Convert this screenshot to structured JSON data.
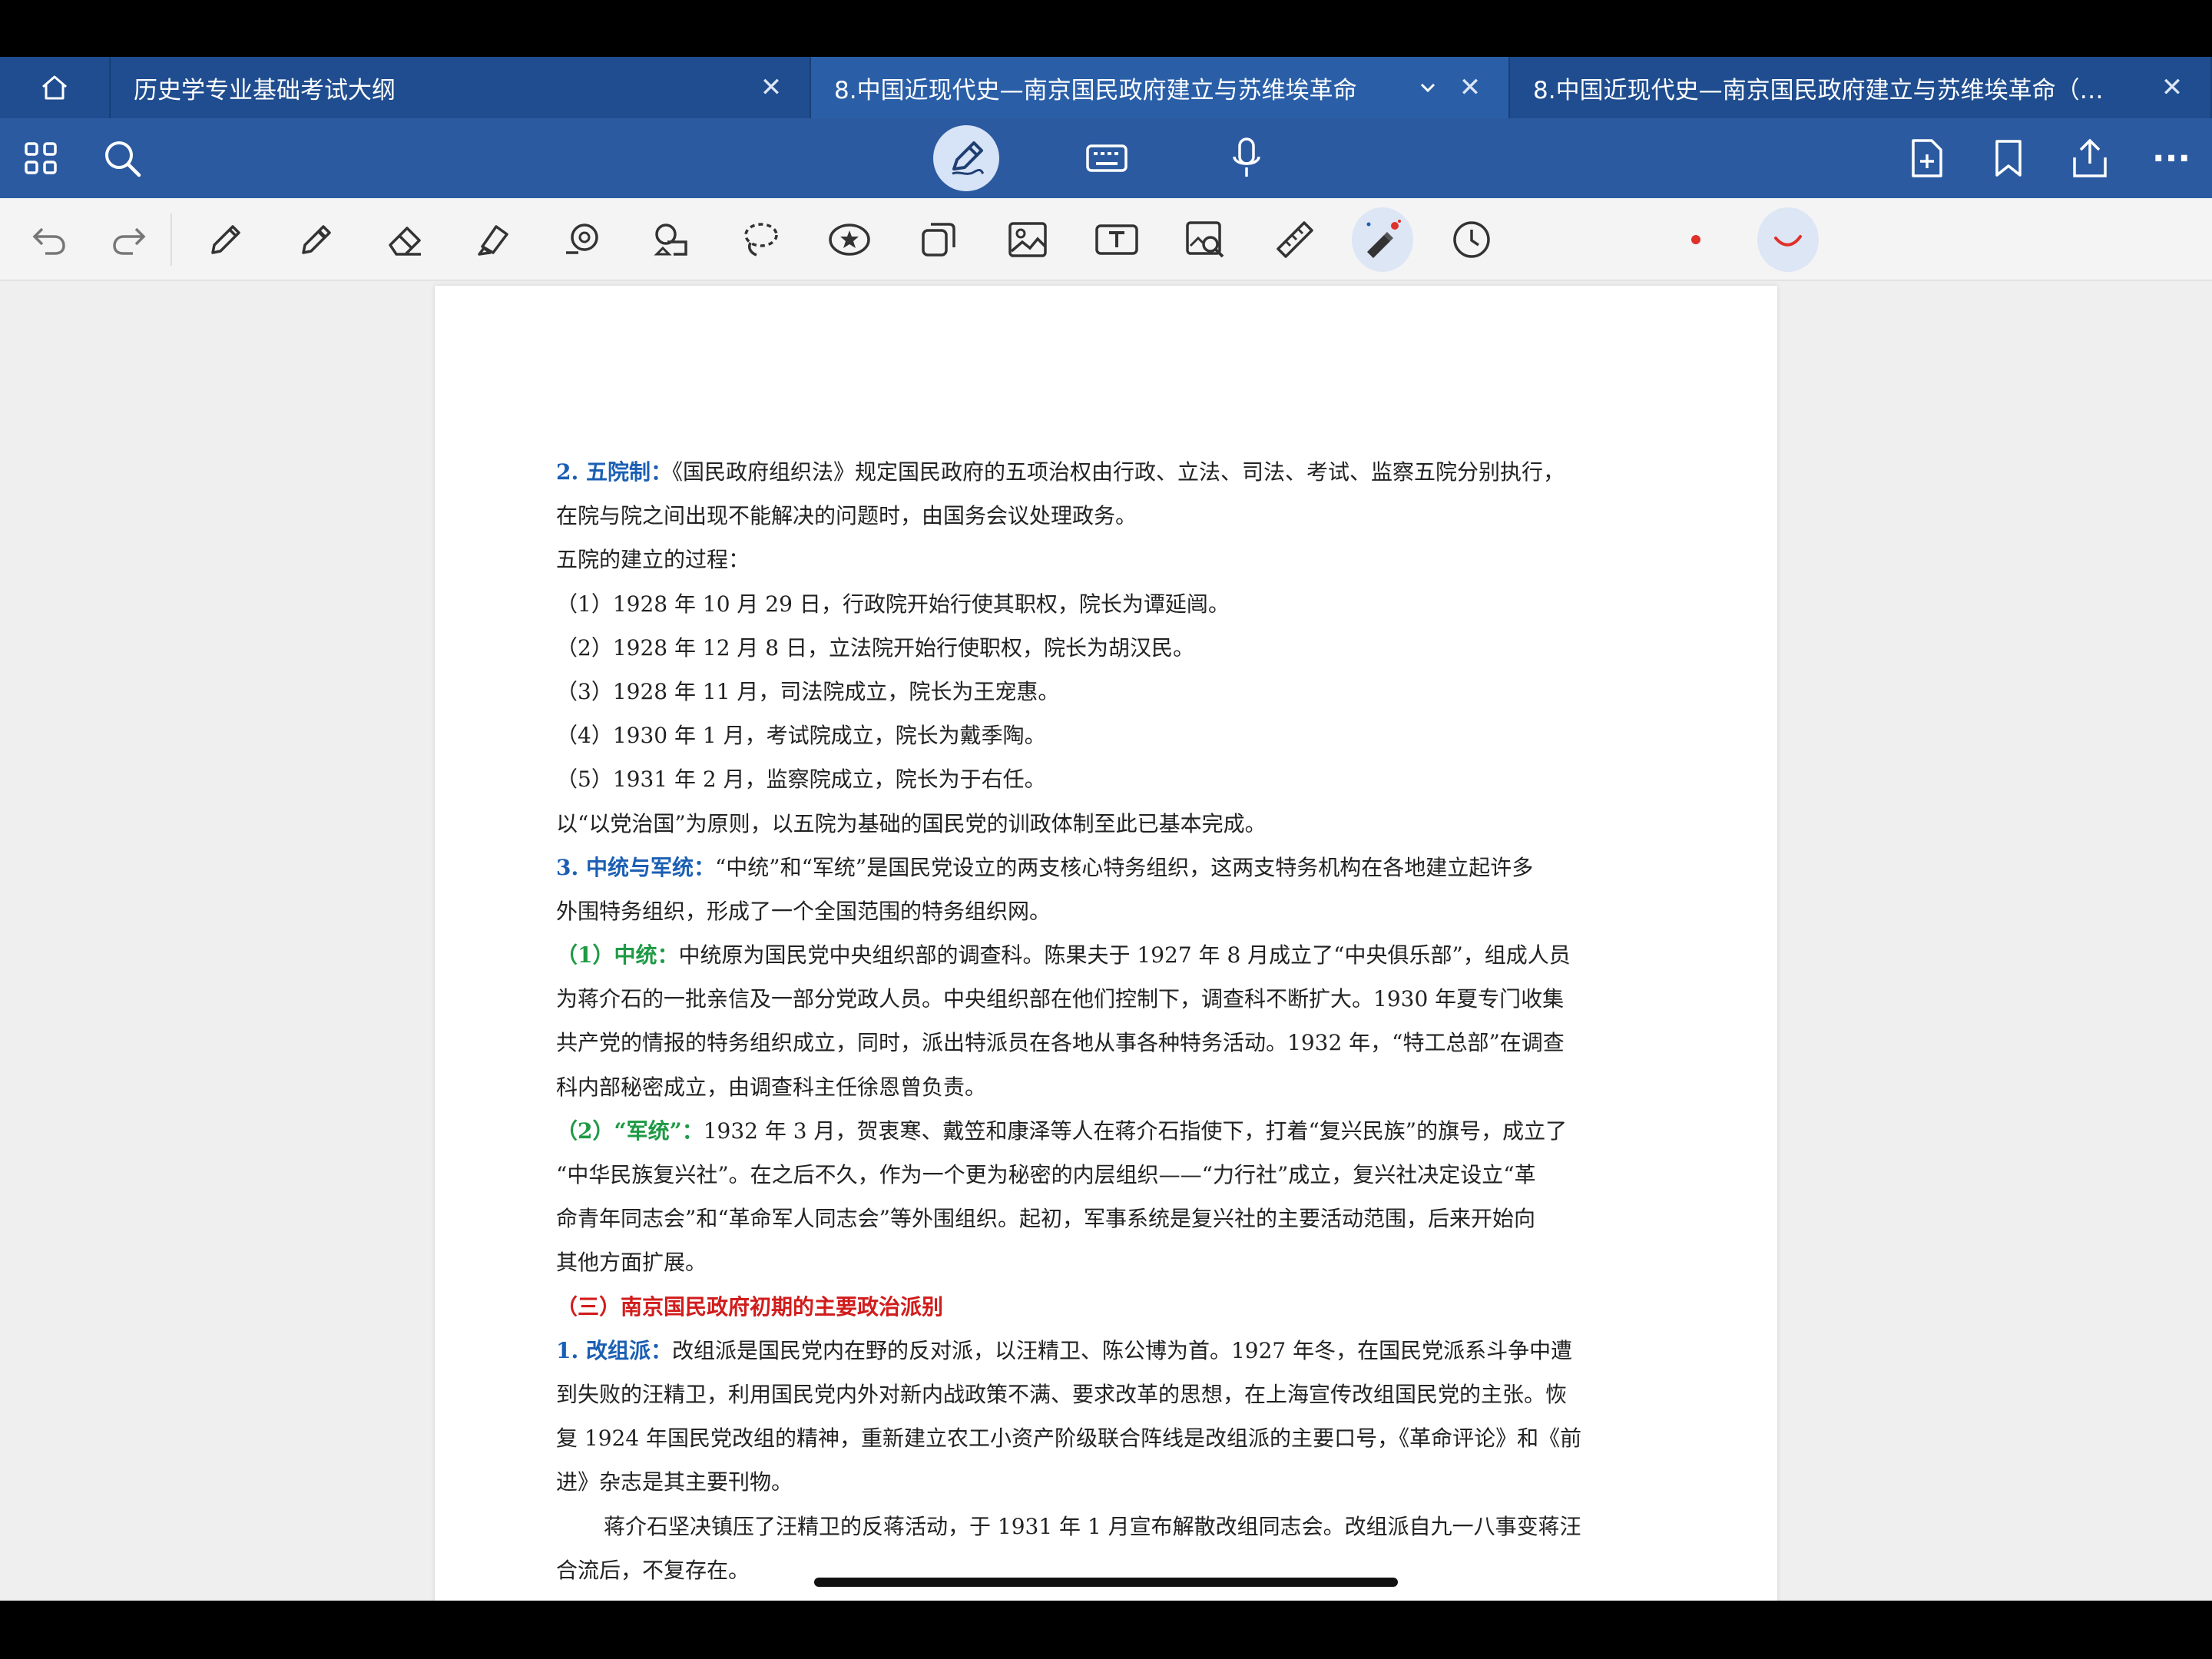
{
  "tabs": [
    {
      "label": "历史学专业基础考试大纲",
      "active": false
    },
    {
      "label": "8.中国近现代史—南京国民政府建立与苏维埃革命",
      "active": true
    },
    {
      "label": "8.中国近现代史—南京国民政府建立与苏维埃革命（…",
      "active": false
    }
  ],
  "tab_close_glyph": "✕",
  "toolbar": {
    "left_icons": [
      "apps-grid-icon",
      "search-icon"
    ],
    "center_icons": [
      "pen-mode-icon",
      "keyboard-icon",
      "microphone-icon"
    ],
    "right_icons": [
      "add-page-icon",
      "bookmark-icon",
      "share-icon",
      "more-icon"
    ],
    "more_glyph": "···"
  },
  "draw_tools": [
    "undo-icon",
    "redo-icon",
    "pen-icon",
    "pencil-icon",
    "eraser-icon",
    "highlighter-icon",
    "shape-icon",
    "shape-recognize-icon",
    "lasso-icon",
    "sticker-icon",
    "shapes-copy-icon",
    "image-icon",
    "text-box-icon",
    "image-search-icon",
    "ruler-icon",
    "laser-pointer-icon",
    "timer-icon"
  ],
  "colors": {
    "accent": "#2c5aa0",
    "tab_bar": "#1f4d8f",
    "heading_blue": "#1b5fb4",
    "heading_green": "#1e9a45",
    "heading_red": "#d11c1c",
    "ink_red": "#e0302a"
  },
  "document": {
    "p1": {
      "heading": "2. 五院制：",
      "line1": "《国民政府组织法》规定国民政府的五项治权由行政、立法、司法、考试、监察五院分别执行，",
      "line2": "在院与院之间出现不能解决的问题时，由国务会议处理政务。"
    },
    "process_title": "五院的建立的过程：",
    "steps": [
      "（1）1928 年 10 月 29 日，行政院开始行使其职权，院长为谭延闿。",
      "（2）1928 年 12 月 8 日，立法院开始行使职权，院长为胡汉民。",
      "（3）1928 年 11 月，司法院成立，院长为王宠惠。",
      "（4）1930 年 1 月，考试院成立，院长为戴季陶。",
      "（5）1931 年 2 月，监察院成立，院长为于右任。"
    ],
    "conclusion": "以“以党治国”为原则，以五院为基础的国民党的训政体制至此已基本完成。",
    "p3": {
      "heading": "3. 中统与军统：",
      "line1": "“中统”和“军统”是国民党设立的两支核心特务组织，这两支特务机构在各地建立起许多",
      "line2": "外围特务组织，形成了一个全国范围的特务组织网。"
    },
    "zhongtong": {
      "heading": "（1）中统：",
      "line1": "中统原为国民党中央组织部的调查科。陈果夫于 1927 年 8 月成立了“中央俱乐部”，组成人员",
      "line2": "为蒋介石的一批亲信及一部分党政人员。中央组织部在他们控制下，调查科不断扩大。1930 年夏专门收集",
      "line3": "共产党的情报的特务组织成立，同时，派出特派员在各地从事各种特务活动。1932 年，“特工总部”在调查",
      "line4": "科内部秘密成立，由调查科主任徐恩曾负责。"
    },
    "juntong": {
      "heading": "（2）“军统”：",
      "line1": "1932 年 3 月，贺衷寒、戴笠和康泽等人在蒋介石指使下，打着“复兴民族”的旗号，成立了",
      "line2": "“中华民族复兴社”。在之后不久，作为一个更为秘密的内层组织——“力行社”成立，复兴社决定设立“革",
      "line3": "命青年同志会”和“革命军人同志会”等外围组织。起初，军事系统是复兴社的主要活动范围，后来开始向",
      "line4": "其他方面扩展。"
    },
    "section3_title": "（三）南京国民政府初期的主要政治派别",
    "gaizupai": {
      "heading": "1. 改组派：",
      "line1": "改组派是国民党内在野的反对派，以汪精卫、陈公博为首。1927 年冬，在国民党派系斗争中遭",
      "line2": "到失败的汪精卫，利用国民党内外对新内战政策不满、要求改革的思想，在上海宣传改组国民党的主张。恢",
      "line3": "复 1924 年国民党改组的精神，重新建立农工小资产阶级联合阵线是改组派的主要口号，《革命评论》和《前",
      "line4": "进》杂志是其主要刊物。"
    },
    "final": {
      "line1": "蒋介石坚决镇压了汪精卫的反蒋活动，于 1931 年 1 月宣布解散改组同志会。改组派自九一八事变蒋汪",
      "line2": "合流后，不复存在。"
    }
  }
}
